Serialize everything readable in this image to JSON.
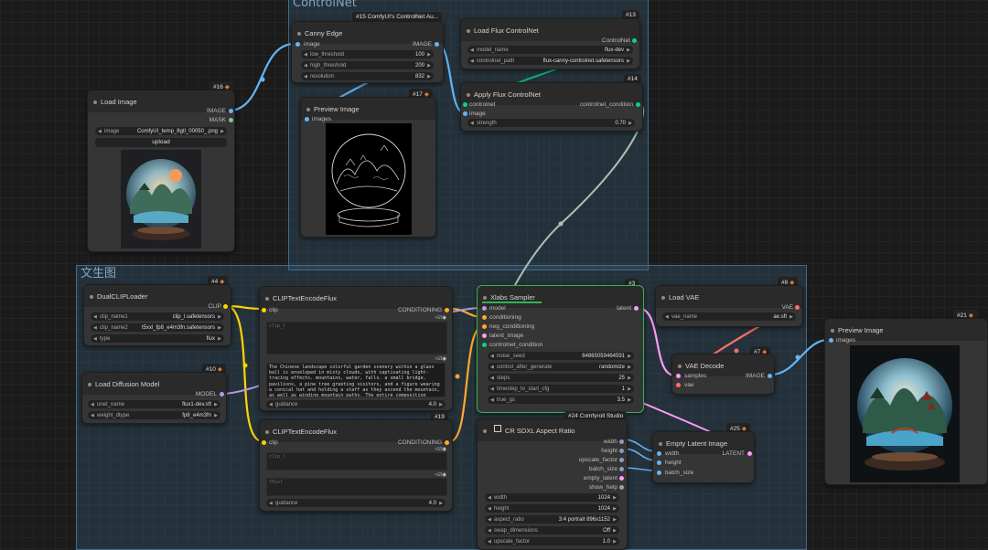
{
  "groups": {
    "controlnet": "ControlNet",
    "txt2img": "文生图"
  },
  "colors": {
    "image": "#64b5f6",
    "mask": "#81c784",
    "controlnet": "#00d78d",
    "clip": "#ffd500",
    "conditioning": "#ffa931",
    "model": "#b39ddb",
    "latent": "#ff9cf9",
    "vae": "#ff6e6e",
    "int": "#8f9cbf"
  },
  "nodes": {
    "load_image": {
      "badge_id": "#16",
      "title": "Load Image",
      "out_image": "IMAGE",
      "out_mask": "MASK",
      "w_image_label": "image",
      "w_image_value": "ComfyUI_temp_8gtl_00050_.png",
      "upload_label": "upload"
    },
    "canny": {
      "badge_id": "#15 ComfyUI's ControlNet Au...",
      "title": "Canny Edge",
      "in_image": "image",
      "out_image": "IMAGE",
      "w_low_label": "low_threshold",
      "w_low_value": "100",
      "w_high_label": "high_threshold",
      "w_high_value": "200",
      "w_res_label": "resolution",
      "w_res_value": "832"
    },
    "preview1": {
      "badge_id": "#17",
      "title": "Preview Image",
      "in_images": "images"
    },
    "load_flux_cn": {
      "badge_id": "#13",
      "title": "Load Flux ControlNet",
      "out_controlnet": "ControlNet",
      "w_model_label": "model_name",
      "w_model_value": "flux-dev",
      "w_path_label": "controlnet_path",
      "w_path_value": "flux-canny-controlnet.safetensors"
    },
    "apply_flux_cn": {
      "badge_id": "#14",
      "title": "Apply Flux ControlNet",
      "in_controlnet": "controlnet",
      "in_image": "image",
      "out_condition": "controlnet_condition",
      "w_strength_label": "strength",
      "w_strength_value": "0.70"
    },
    "dual_clip": {
      "badge_id": "#4",
      "title": "DualCLIPLoader",
      "out_clip": "CLIP",
      "w_c1_label": "clip_name1",
      "w_c1_value": "clip_l.safetensors",
      "w_c2_label": "clip_name2",
      "w_c2_value": "t5xxl_fp8_e4m3fn.safetensors",
      "w_type_label": "type",
      "w_type_value": "flux"
    },
    "diffusion": {
      "badge_id": "#10",
      "title": "Load Diffusion Model",
      "out_model": "MODEL",
      "w_unet_label": "unet_name",
      "w_unet_value": "flux1-dev.sft",
      "w_dtype_label": "weight_dtype",
      "w_dtype_value": "fp8_e4m3fn"
    },
    "clip_enc1": {
      "badge_id": "#5",
      "title": "CLIPTextEncodeFlux",
      "in_clip": "clip",
      "out_cond": "CONDITIONING",
      "ph_clip_l": "clip_l",
      "prompt": "The Chinese landscape colorful garden scenery within a glass ball is enveloped in misty clouds, with captivating light-tracing effects. mountains, water, falls. a small bridge, pavilions, a pine tree greeting visitors, and a figure wearing a conical hat and holding a staff as they ascend the mountain, as well as winding mountain paths. The entire composition presents an exquisite level of detail and aesthetic appeal.",
      "w_guidance_label": "guidance",
      "w_guidance_value": "4.0"
    },
    "clip_enc2": {
      "badge_id": "#19",
      "title": "CLIPTextEncodeFlux",
      "in_clip": "clip",
      "out_cond": "CONDITIONING",
      "ph_clip_l": "clip_l",
      "ph_t5xxl": "t5xxl",
      "w_guidance_label": "guidance",
      "w_guidance_value": "4.0"
    },
    "sampler": {
      "badge_id": "#3",
      "title": "Xlabs Sampler",
      "in_model": "model",
      "in_cond": "conditioning",
      "in_neg": "neg_conditioning",
      "in_latent": "latent_image",
      "in_cn": "controlnet_condition",
      "out_latent": "latent",
      "w_seed_label": "noise_seed",
      "w_seed_value": "84865059464591",
      "w_cag_label": "control_after_generate",
      "w_cag_value": "randomize",
      "w_steps_label": "steps",
      "w_steps_value": "25",
      "w_ts_label": "timestep_to_start_cfg",
      "w_ts_value": "1",
      "w_gs_label": "true_gs",
      "w_gs_value": "3.5"
    },
    "load_vae": {
      "badge_id": "#8",
      "title": "Load VAE",
      "out_vae": "VAE",
      "w_vae_label": "vae_name",
      "w_vae_value": "ae.sft"
    },
    "vae_decode": {
      "badge_id": "#7",
      "title": "VAE Decode",
      "in_samples": "samples",
      "in_vae": "vae",
      "out_image": "IMAGE"
    },
    "preview2": {
      "badge_id": "#21",
      "title": "Preview Image",
      "in_images": "images"
    },
    "aspect": {
      "badge_id": "#24 Comfyroll Studio",
      "title": "CR SDXL Aspect Ratio",
      "out_width": "width",
      "out_height": "height",
      "out_upscale": "upscale_factor",
      "out_batch": "batch_size",
      "out_latent": "empty_latent",
      "out_help": "show_help",
      "w_width_label": "width",
      "w_width_value": "1024",
      "w_height_label": "height",
      "w_height_value": "1024",
      "w_ratio_label": "aspect_ratio",
      "w_ratio_value": "3:4 portrait 896x1152",
      "w_swap_label": "swap_dimensions",
      "w_swap_value": "Off",
      "w_up_label": "upscale_factor",
      "w_up_value": "1.0"
    },
    "empty_latent": {
      "badge_id": "#25",
      "title": "Empty Latent Image",
      "in_width": "width",
      "in_height": "height",
      "in_batch": "batch_size",
      "out_latent": "LATENT"
    }
  }
}
